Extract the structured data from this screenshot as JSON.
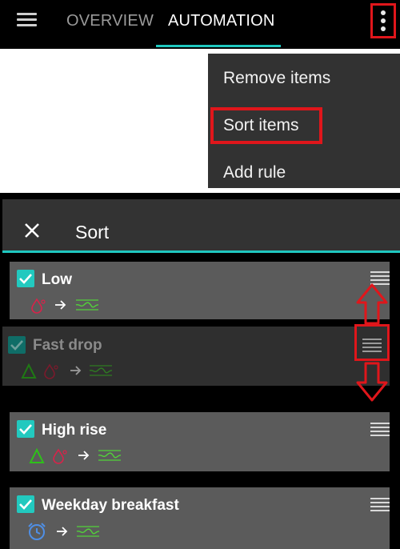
{
  "app": {
    "tabs": [
      {
        "label": "OVERVIEW",
        "active": false
      },
      {
        "label": "AUTOMATION",
        "active": true
      }
    ],
    "menu_icon": "hamburger-icon",
    "more_icon": "more-vertical-icon"
  },
  "overflow_menu": {
    "items": [
      "Remove items",
      "Sort items",
      "Add rule"
    ],
    "highlighted": "Sort items"
  },
  "sort_screen": {
    "title": "Sort",
    "close_icon": "close-icon",
    "rules": [
      {
        "name": "Low",
        "checked": true,
        "icons": [
          "drop-icon",
          "arrow-right-icon",
          "glucose-trend-icon"
        ]
      },
      {
        "name": "Fast drop",
        "checked": true,
        "dragging": true,
        "icons": [
          "delta-icon",
          "drop-icon",
          "arrow-right-icon",
          "glucose-trend-icon"
        ]
      },
      {
        "name": "High rise",
        "checked": true,
        "icons": [
          "delta-icon",
          "drop-icon",
          "arrow-right-icon",
          "glucose-trend-icon"
        ]
      },
      {
        "name": "Weekday breakfast",
        "checked": true,
        "icons": [
          "alarm-clock-icon",
          "arrow-right-icon",
          "glucose-trend-icon"
        ]
      }
    ],
    "drag_handle_icon": "drag-handle-icon"
  },
  "colors": {
    "accent": "#1fc8c0",
    "annotation": "#e0161b",
    "drop": "#d8234a",
    "delta": "#2ec01a",
    "trend": "#52d23a",
    "clock": "#4f8fe6"
  }
}
